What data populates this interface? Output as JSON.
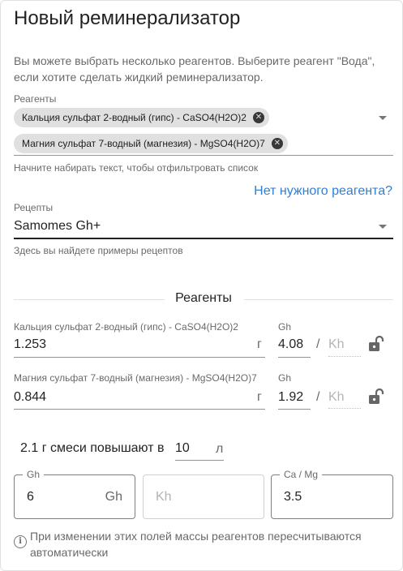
{
  "title": "Новый реминерализатор",
  "description": "Вы можете выбрать несколько реагентов. Выберите реагент \"Вода\", если хотите сделать жидкий реминерализатор.",
  "reagents_select": {
    "label": "Реагенты",
    "chips": [
      {
        "label": "Кальция сульфат 2-водный (гипс) - CaSO4(H2O)2"
      },
      {
        "label": "Магния сульфат 7-водный (магнезия) - MgSO4(H2O)7"
      }
    ],
    "helper": "Начните набирать текст, чтобы отфильтровать список"
  },
  "missing_reagent_link": "Нет нужного реагента?",
  "recipes": {
    "label": "Рецепты",
    "value": "Samomes Gh+",
    "helper": "Здесь вы найдете примеры рецептов"
  },
  "section_title": "Реагенты",
  "reagent_rows": [
    {
      "label": "Кальция сульфат 2-водный (гипс) - CaSO4(H2O)2",
      "amount": "1.253",
      "unit": "г",
      "gh_label": "Gh",
      "gh_value": "4.08",
      "separator": "/",
      "kh_placeholder": "Kh"
    },
    {
      "label": "Магния сульфат 7-водный (магнезия) - MgSO4(H2O)7",
      "amount": "0.844",
      "unit": "г",
      "gh_label": "Gh",
      "gh_value": "1.92",
      "separator": "/",
      "kh_placeholder": "Kh"
    }
  ],
  "mix": {
    "text": "2.1 г смеси повышают в",
    "volume": "10",
    "unit": "л"
  },
  "summary": {
    "gh": {
      "label": "Gh",
      "value": "6",
      "suffix": "Gh"
    },
    "kh": {
      "placeholder": "Kh"
    },
    "ratio": {
      "label": "Ca / Mg",
      "value": "3.5"
    }
  },
  "info_text": "При изменении этих полей массы реагентов пересчитываются автоматически",
  "icons": {
    "chip_delete": "close-circle-icon",
    "dropdown": "arrow-drop-down-icon",
    "lock": "lock-open-icon",
    "info": "info-outline-icon"
  },
  "colors": {
    "link": "#2f7fd9",
    "chip_bg": "#e0e0e0"
  }
}
